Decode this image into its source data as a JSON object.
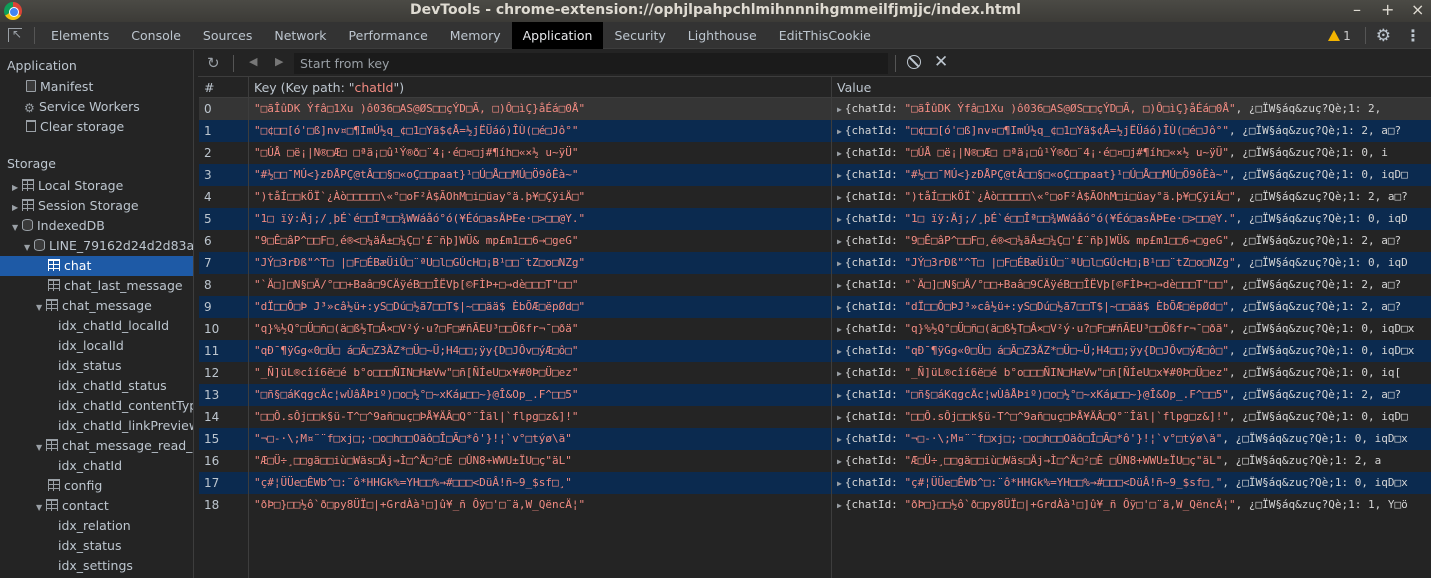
{
  "window": {
    "title": "DevTools - chrome-extension://ophjlpahpchlmihnnnihgmmeilfjmjjc/index.html",
    "controls": [
      "–",
      "+",
      "×"
    ]
  },
  "tabs": [
    "Elements",
    "Console",
    "Sources",
    "Network",
    "Performance",
    "Memory",
    "Application",
    "Security",
    "Lighthouse",
    "EditThisCookie"
  ],
  "active_tab": "Application",
  "warnings": {
    "count": "1"
  },
  "sidebar": {
    "application_header": "Application",
    "application_items": [
      "Manifest",
      "Service Workers",
      "Clear storage"
    ],
    "storage_header": "Storage",
    "storage_items": {
      "local_storage": "Local Storage",
      "session_storage": "Session Storage",
      "indexeddb": "IndexedDB",
      "db": "LINE_79162d24d2d83a4",
      "chat": "chat",
      "chat_last_message": "chat_last_message",
      "chat_message": "chat_message",
      "idx_chatId_localId": "idx_chatId_localId",
      "idx_localId": "idx_localId",
      "idx_status": "idx_status",
      "idx_chatId_status": "idx_chatId_status",
      "idx_chatId_contentType": "idx_chatId_contentType",
      "idx_chatId_linkPreview": "idx_chatId_linkPreview",
      "chat_message_read_c": "chat_message_read_c",
      "idx_chatId": "idx_chatId",
      "config": "config",
      "contact": "contact",
      "idx_relation": "idx_relation",
      "idx_status2": "idx_status",
      "idx_settings": "idx_settings"
    }
  },
  "toolbar": {
    "search_placeholder": "Start from key"
  },
  "table": {
    "headers": {
      "num": "#",
      "key_prefix": "Key (Key path: \"",
      "key_path": "chatId",
      "key_suffix": "\")",
      "value": "Value"
    },
    "value_prefix": "{chatId: ",
    "rows": [
      {
        "num": "0",
        "key": "\"□ãÎûDK Ýfâ□1Xu )ô036□AS@ØS□□çÝD□Ã, □)Ô□ìÇ}åÉá□0Å\"",
        "value_key": "\"□ãÎûDK    Ýfâ□1Xu )ô036□AS@ØS□□çÝD□Ã, □)Ô□ìÇ}åÉá□0Å\"",
        "value_rest": ", ¿□ÏW§áq&zuç?Qè;1: 2,"
      },
      {
        "num": "1",
        "key": "\"□¢□□[ó'□ß]nv¤□¶ImÚ½q_¢□1□Yä$¢Å=½jËÜáó)ÎÙ(□é□Jô°\"",
        "value_key": "\"□¢□□[ó'□ß]nv¤□¶ImÚ½q_¢□1□Yä$¢Å=½jËÜáó)ÎÙ(□é□Jô°\"",
        "value_rest": ", ¿□ÏW§áq&zuç?Qè;1: 2, a□?"
      },
      {
        "num": "2",
        "key": "\"□ÚÅ    □ë¡|N®□Æ□ □ªä¡□û¹Ý®ð□¨4¡·é□¤□j#¶íh□«×½  u~ÿÜ\"",
        "value_key": "\"□ÚÅ    □ë¡|N®□Æ□ □ªä¡□û¹Ý®ð□¨4¡·é□¤□j#¶íh□«×½  u~ÿÜ\"",
        "value_rest": ", ¿□ÏW§áq&zuç?Qè;1: 0, i"
      },
      {
        "num": "3",
        "key": "\"#½□□¯MÚ<}zÐÅPÇ@tÂ□□§□«oÇ□□paat}¹□Ú□Å□□MÚ□Ö9ôÊà~\"",
        "value_key": "\"#½□□¯MÚ<}zÐÅPÇ@tÂ□□§□«oÇ□□paat}¹□Ú□Å□□MÚ□Ö9ôÊà~\"",
        "value_rest": ", ¿□ÏW§áq&zuç?Qè;1: 0, iqD□"
      },
      {
        "num": "4",
        "key": "\")tåÍ□□kÖÏ`¿Àò□□□□□\\«°□oF²À$ÃOhM□i□üay°ä.þ¥□ÇÿiÄ□\"",
        "value_key": "\")tåÍ□□kÖÏ`¿Àò□□□□□\\«°□oF²À$ÃOhM□i□üay°ä.þ¥□ÇÿiÄ□\"",
        "value_rest": ", ¿□ÏW§áq&zuç?Qè;1: 2, a□?"
      },
      {
        "num": "5",
        "key": "\"1□ ïÿ:Äj;/¸þÉ`é□□Îª□□¾WWáåó°ó(¥Éó□asÄÞEe·□>□□@Y.\"",
        "value_key": "\"1□ ïÿ:Äj;/¸þÉ`é□□Îª□□¾WWáåó°ó(¥Éó□asÄÞEe·□>□□@Y.\"",
        "value_rest": ", ¿□ÏW§áq&zuç?Qè;1: 0, iqD"
      },
      {
        "num": "6",
        "key": "\"9□Ê□âP^□□F□¸é®<□¼äÂ±□¼Ç□'£¨ñþ]WÜ&  mp£m1□□6→□geG\"",
        "value_key": "\"9□Ê□âP^□□F□¸é®<□¼äÂ±□¼Ç□'£¨ñþ]WÜ&  mp£m1□□6→□geG\"",
        "value_rest": ", ¿□ÏW§áq&zuç?Qè;1: 2, a□?"
      },
      {
        "num": "7",
        "key": "\"JÝ□3rÐß\"^T□ |□F□ÉBæÜiÛ□¨ªU□l□GÚcH□¡B¹□□¨tZ□o□NZg\"",
        "value_key": "\"JÝ□3rÐß\"^T□ |□F□ÉBæÜiÛ□¨ªU□l□GÚcH□¡B¹□□¨tZ□o□NZg\"",
        "value_rest": ", ¿□ÏW§áq&zuç?Qè;1: 0, iqD"
      },
      {
        "num": "8",
        "key": "\"`Ä□]□N§□Ä/°□□+Baâ□9CÄÿéB□□ÎËVþ[©FÌÞ+□→dè□□□T\"□□\"",
        "value_key": "\"`Ä□]□N§□Ä/°□□+Baâ□9CÄÿéB□□ÎËVþ[©FÌÞ+□→dè□□□T\"□□\"",
        "value_rest": ", ¿□ÏW§áq&zuç?Qè;1: 2, a□?"
      },
      {
        "num": "9",
        "key": "\"dÏ□□Ô□Þ J³»câ½ü+:yS□Dú□½ã7□□T$|~□□ää$ ÈbÕÆ□ëpØd□\"",
        "value_key": "\"dÏ□□Ô□ÞJ³»câ½ü+:yS□Dú□½ã7□□T$|~□□ää$ ÈbÕÆ□ëpØd□\"",
        "value_rest": ", ¿□ÏW§áq&zuç?Qè;1: 2, a□?"
      },
      {
        "num": "10",
        "key": "\"q}%½Q°□Ü□ñ□(ä□ß½T□Â×□V²ý·u?□F□#ñÃEU³□□Õßfr¬¯□ðä\"",
        "value_key": "\"q}%½Q°□Ü□ñ□(ä□ß½T□Â×□V²ý·u?□F□#ñÃEU³□□Õßfr¬¯□ðä\"",
        "value_rest": ", ¿□ÏW§áq&zuç?Qè;1: 0, iqD□x"
      },
      {
        "num": "11",
        "key": "\"qÐ¯¶ÿGg«0□Ü□ á□Ã□Z3ÄZ*□Ü□~Ü;H4□□;ÿy{D□JÔv□ýÆ□ô□\"",
        "value_key": "\"qÐ¯¶ÿGg«0□Ü□ á□Ã□Z3ÄZ*□Ü□~Ü;H4□□;ÿy{D□JÔv□ýÆ□ô□\"",
        "value_rest": ", ¿□ÏW§áq&zuç?Qè;1: 0, iqD□x"
      },
      {
        "num": "12",
        "key": "\"_Ñ]üL®cîí6ë□é b°o□□□ÑIN□HæVw\"□ñ[ÑÍeU□x¥#0Þ□Ü□ez\"",
        "value_key": "\"_Ñ]üL®cîí6ë□é b°o□□□ÑIN□HæVw\"□ñ[ÑÍeU□x¥#0Þ□Ü□ez\"",
        "value_rest": ", ¿□ÏW§áq&zuç?Qè;1: 0, iq["
      },
      {
        "num": "13",
        "key": "\"□ñ§□áKqgcÄc¦wÙâÅÞiº)□o□½°□~xKáµ□□~}@Î&Op_.F^□□5\"",
        "value_key": "\"□ñ§□áKqgcÄc¦wÙâÅÞiº)□o□½°□~xKáµ□□~}@Î&Op_.F^□□5\"",
        "value_rest": ", ¿□ÏW§áq&zuç?Qè;1: 2, a□?"
      },
      {
        "num": "14",
        "key": "\"□□Ô.sÔj□□k§ü-T^□^9añ□uç□ÞÅ¥ÄÂ□Q°¨Îäl|`flpg□z&]!\"",
        "value_key": "\"□□Ô.sÔj□□k§ü-T^□^9añ□uç□ÞÅ¥ÄÂ□Q°¨Îäl|`flpg□z&]!\"",
        "value_rest": ", ¿□ÏW§áq&zuç?Qè;1: 0, iqD□"
      },
      {
        "num": "15",
        "key": "\"¬□-·\\;M¤¨¨f□xj□;·□o□h□□Oäô□Î□Ã□*ô'}!¦`v°□týø\\ä\"",
        "value_key": "\"¬□-·\\;M¤¨¨f□xj□;·□o□h□□Oäô□Î□Ã□*ô'}!¦`v°□týø\\ä\"",
        "value_rest": ", ¿□ÏW§áq&zuç?Qè;1: 0, iqD□x"
      },
      {
        "num": "16",
        "key": "\"Æ□Ü÷¸□□gä□□iù□Wäs□Äj→Ì□^Ä□²□È   □ÛN8+WWU±ÏU□ç\"äL\"",
        "value_key": "\"Æ□Ü÷¸□□gä□□iù□Wäs□Äj→Ì□^Ä□²□È     □ÛN8+WWU±ÏU□ç\"äL\"",
        "value_rest": ", ¿□ÏW§áq&zuç?Qè;1: 2, a"
      },
      {
        "num": "17",
        "key": "\"ç#¦ÜÜe□ÊWb^□:¨ô*HHGk%=YH□□%→#□□□<DüÂ!ñ~9_$sf□¸\"",
        "value_key": "\"ç#¦ÜÜe□ÊWb^□:¨ô*HHGk%=YH□□%→#□□□<DüÂ!ñ~9_$sf□¸\"",
        "value_rest": ", ¿□ÏW§áq&zuç?Qè;1: 0, iqD□x"
      },
      {
        "num": "18",
        "key": "\"ðÞ□}□□½ô`ð□py8ÜÏ□|+GrdÀà¹□]û¥_ñ Ôÿ□'□¨ä,W_QëncÄ¦\"",
        "value_key": "\"ðÞ□}□□½ô`ð□py8ÜÏ□|+GrdÀà¹□]û¥_ñ Ôÿ□'□¨ä,W_QëncÄ¦\"",
        "value_rest": ", ¿□ÏW§áq&zuç?Qè;1: 1, Y□ö"
      }
    ]
  }
}
